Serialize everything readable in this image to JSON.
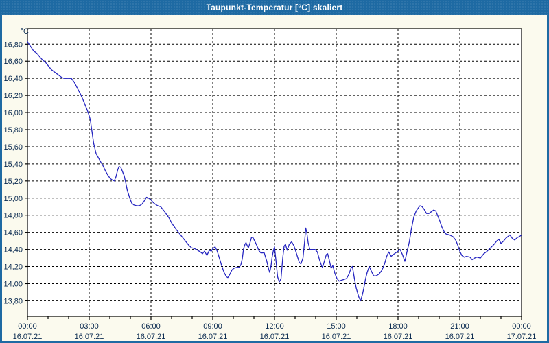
{
  "window": {
    "title": "Taupunkt-Temperatur [°C] skaliert"
  },
  "colors": {
    "titlebar": "#1E6AA3",
    "window_bg": "#FBFAEE",
    "plot_bg": "#FFFFFF",
    "frame": "#000000",
    "grid": "#000000",
    "label_text": "#0A2A50",
    "title_text": "#FFFFFF",
    "line": "#2424C0"
  },
  "chart_data": {
    "type": "line",
    "title": "Taupunkt-Temperatur [°C] skaliert",
    "grid": {
      "horizontal": "dashed",
      "vertical_major": "dashed"
    },
    "y_axis": {
      "unit": "°C",
      "decimal_separator": ",",
      "tick_values": [
        16.8,
        16.6,
        16.4,
        16.2,
        16.0,
        15.8,
        15.6,
        15.4,
        15.2,
        15.0,
        14.8,
        14.6,
        14.4,
        14.2,
        14.0,
        13.8
      ],
      "tick_labels": [
        "16,80",
        "16,60",
        "16,40",
        "16,20",
        "16,00",
        "15,80",
        "15,60",
        "15,40",
        "15,20",
        "15,00",
        "14,80",
        "14,60",
        "14,40",
        "14,20",
        "14,00",
        "13,80"
      ]
    },
    "x_axis": {
      "range_hours": [
        0,
        24
      ],
      "minor_tick_every_hours": 1,
      "major_tick_hours": [
        0,
        3,
        6,
        9,
        12,
        15,
        18,
        21,
        24
      ],
      "tick_times": [
        "00:00",
        "03:00",
        "06:00",
        "09:00",
        "12:00",
        "15:00",
        "18:00",
        "21:00",
        "00:00"
      ],
      "tick_dates": [
        "16.07.21",
        "16.07.21",
        "16.07.21",
        "16.07.21",
        "16.07.21",
        "16.07.21",
        "16.07.21",
        "16.07.21",
        "17.07.21"
      ]
    },
    "series": [
      {
        "name": "Taupunkt-Temperatur",
        "unit": "°C",
        "color": "#2424C0",
        "points_minute_value": [
          [
            0,
            16.83
          ],
          [
            8,
            16.78
          ],
          [
            18,
            16.72
          ],
          [
            28,
            16.69
          ],
          [
            36,
            16.65
          ],
          [
            45,
            16.61
          ],
          [
            52,
            16.59
          ],
          [
            60,
            16.55
          ],
          [
            70,
            16.5
          ],
          [
            80,
            16.47
          ],
          [
            90,
            16.44
          ],
          [
            100,
            16.41
          ],
          [
            106,
            16.4
          ],
          [
            128,
            16.4
          ],
          [
            137,
            16.35
          ],
          [
            146,
            16.28
          ],
          [
            154,
            16.22
          ],
          [
            162,
            16.15
          ],
          [
            170,
            16.07
          ],
          [
            177,
            16.0
          ],
          [
            183,
            15.92
          ],
          [
            188,
            15.78
          ],
          [
            193,
            15.64
          ],
          [
            200,
            15.52
          ],
          [
            207,
            15.47
          ],
          [
            214,
            15.42
          ],
          [
            220,
            15.38
          ],
          [
            227,
            15.32
          ],
          [
            234,
            15.27
          ],
          [
            241,
            15.23
          ],
          [
            248,
            15.21
          ],
          [
            253,
            15.2
          ],
          [
            258,
            15.25
          ],
          [
            263,
            15.33
          ],
          [
            267,
            15.37
          ],
          [
            272,
            15.36
          ],
          [
            277,
            15.31
          ],
          [
            282,
            15.26
          ],
          [
            287,
            15.17
          ],
          [
            291,
            15.09
          ],
          [
            295,
            15.04
          ],
          [
            299,
            14.99
          ],
          [
            304,
            14.94
          ],
          [
            310,
            14.92
          ],
          [
            318,
            14.91
          ],
          [
            326,
            14.91
          ],
          [
            334,
            14.93
          ],
          [
            341,
            14.97
          ],
          [
            347,
            15.01
          ],
          [
            353,
            15.0
          ],
          [
            360,
            14.98
          ],
          [
            366,
            14.95
          ],
          [
            372,
            14.93
          ],
          [
            380,
            14.91
          ],
          [
            388,
            14.9
          ],
          [
            394,
            14.87
          ],
          [
            400,
            14.84
          ],
          [
            407,
            14.8
          ],
          [
            414,
            14.76
          ],
          [
            420,
            14.71
          ],
          [
            427,
            14.67
          ],
          [
            434,
            14.63
          ],
          [
            440,
            14.6
          ],
          [
            450,
            14.55
          ],
          [
            460,
            14.5
          ],
          [
            470,
            14.45
          ],
          [
            478,
            14.42
          ],
          [
            487,
            14.41
          ],
          [
            496,
            14.39
          ],
          [
            504,
            14.37
          ],
          [
            510,
            14.35
          ],
          [
            516,
            14.38
          ],
          [
            523,
            14.33
          ],
          [
            530,
            14.39
          ],
          [
            536,
            14.38
          ],
          [
            540,
            14.41
          ],
          [
            547,
            14.43
          ],
          [
            553,
            14.38
          ],
          [
            560,
            14.29
          ],
          [
            566,
            14.21
          ],
          [
            573,
            14.13
          ],
          [
            580,
            14.08
          ],
          [
            584,
            14.07
          ],
          [
            590,
            14.11
          ],
          [
            596,
            14.16
          ],
          [
            602,
            14.18
          ],
          [
            610,
            14.19
          ],
          [
            617,
            14.19
          ],
          [
            622,
            14.22
          ],
          [
            626,
            14.29
          ],
          [
            630,
            14.41
          ],
          [
            634,
            14.46
          ],
          [
            637,
            14.48
          ],
          [
            641,
            14.44
          ],
          [
            644,
            14.42
          ],
          [
            648,
            14.47
          ],
          [
            653,
            14.54
          ],
          [
            657,
            14.54
          ],
          [
            662,
            14.5
          ],
          [
            668,
            14.45
          ],
          [
            674,
            14.39
          ],
          [
            680,
            14.36
          ],
          [
            690,
            14.36
          ],
          [
            697,
            14.27
          ],
          [
            703,
            14.17
          ],
          [
            706,
            14.13
          ],
          [
            710,
            14.21
          ],
          [
            713,
            14.31
          ],
          [
            717,
            14.39
          ],
          [
            720,
            14.43
          ],
          [
            724,
            14.28
          ],
          [
            729,
            14.08
          ],
          [
            734,
            14.02
          ],
          [
            739,
            14.06
          ],
          [
            744,
            14.3
          ],
          [
            748,
            14.44
          ],
          [
            752,
            14.46
          ],
          [
            757,
            14.39
          ],
          [
            763,
            14.46
          ],
          [
            770,
            14.49
          ],
          [
            777,
            14.44
          ],
          [
            785,
            14.34
          ],
          [
            792,
            14.25
          ],
          [
            797,
            14.23
          ],
          [
            803,
            14.3
          ],
          [
            808,
            14.5
          ],
          [
            811,
            14.65
          ],
          [
            814,
            14.6
          ],
          [
            818,
            14.48
          ],
          [
            823,
            14.4
          ],
          [
            830,
            14.4
          ],
          [
            838,
            14.4
          ],
          [
            845,
            14.37
          ],
          [
            851,
            14.28
          ],
          [
            857,
            14.21
          ],
          [
            860,
            14.19
          ],
          [
            866,
            14.27
          ],
          [
            871,
            14.34
          ],
          [
            875,
            14.35
          ],
          [
            880,
            14.27
          ],
          [
            885,
            14.18
          ],
          [
            890,
            14.21
          ],
          [
            896,
            14.12
          ],
          [
            902,
            14.06
          ],
          [
            908,
            14.03
          ],
          [
            915,
            14.04
          ],
          [
            923,
            14.05
          ],
          [
            930,
            14.06
          ],
          [
            937,
            14.11
          ],
          [
            943,
            14.18
          ],
          [
            947,
            14.2
          ],
          [
            952,
            14.08
          ],
          [
            958,
            13.95
          ],
          [
            966,
            13.84
          ],
          [
            971,
            13.8
          ],
          [
            976,
            13.87
          ],
          [
            980,
            13.94
          ],
          [
            985,
            14.05
          ],
          [
            990,
            14.13
          ],
          [
            996,
            14.2
          ],
          [
            1003,
            14.14
          ],
          [
            1009,
            14.09
          ],
          [
            1016,
            14.09
          ],
          [
            1024,
            14.11
          ],
          [
            1032,
            14.15
          ],
          [
            1040,
            14.22
          ],
          [
            1047,
            14.32
          ],
          [
            1053,
            14.37
          ],
          [
            1060,
            14.32
          ],
          [
            1066,
            14.34
          ],
          [
            1073,
            14.36
          ],
          [
            1080,
            14.38
          ],
          [
            1086,
            14.4
          ],
          [
            1093,
            14.34
          ],
          [
            1100,
            14.26
          ],
          [
            1106,
            14.37
          ],
          [
            1113,
            14.49
          ],
          [
            1119,
            14.64
          ],
          [
            1126,
            14.78
          ],
          [
            1133,
            14.85
          ],
          [
            1140,
            14.89
          ],
          [
            1144,
            14.91
          ],
          [
            1150,
            14.9
          ],
          [
            1156,
            14.87
          ],
          [
            1163,
            14.82
          ],
          [
            1170,
            14.82
          ],
          [
            1177,
            14.84
          ],
          [
            1184,
            14.86
          ],
          [
            1190,
            14.85
          ],
          [
            1196,
            14.79
          ],
          [
            1202,
            14.73
          ],
          [
            1208,
            14.66
          ],
          [
            1214,
            14.61
          ],
          [
            1220,
            14.58
          ],
          [
            1230,
            14.57
          ],
          [
            1240,
            14.55
          ],
          [
            1248,
            14.51
          ],
          [
            1254,
            14.45
          ],
          [
            1260,
            14.38
          ],
          [
            1266,
            14.33
          ],
          [
            1273,
            14.31
          ],
          [
            1280,
            14.32
          ],
          [
            1290,
            14.31
          ],
          [
            1296,
            14.28
          ],
          [
            1303,
            14.3
          ],
          [
            1310,
            14.31
          ],
          [
            1320,
            14.3
          ],
          [
            1330,
            14.35
          ],
          [
            1340,
            14.38
          ],
          [
            1350,
            14.42
          ],
          [
            1360,
            14.46
          ],
          [
            1368,
            14.5
          ],
          [
            1374,
            14.52
          ],
          [
            1380,
            14.47
          ],
          [
            1388,
            14.5
          ],
          [
            1394,
            14.53
          ],
          [
            1400,
            14.55
          ],
          [
            1406,
            14.57
          ],
          [
            1413,
            14.53
          ],
          [
            1420,
            14.51
          ],
          [
            1428,
            14.54
          ],
          [
            1434,
            14.55
          ],
          [
            1440,
            14.57
          ]
        ]
      }
    ]
  }
}
